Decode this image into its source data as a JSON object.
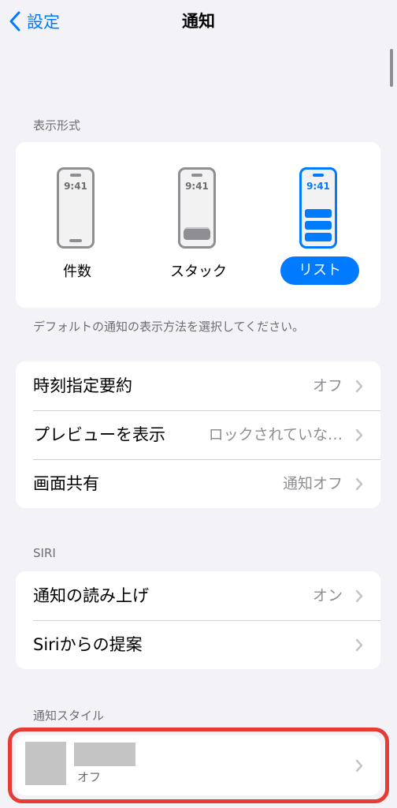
{
  "nav": {
    "back_label": "設定",
    "title": "通知"
  },
  "display_style": {
    "header": "表示形式",
    "options": [
      {
        "label": "件数",
        "time": "9:41",
        "selected": false
      },
      {
        "label": "スタック",
        "time": "9:41",
        "selected": false
      },
      {
        "label": "リスト",
        "time": "9:41",
        "selected": true
      }
    ],
    "footer": "デフォルトの通知の表示方法を選択してください。"
  },
  "general": {
    "rows": [
      {
        "label": "時刻指定要約",
        "value": "オフ"
      },
      {
        "label": "プレビューを表示",
        "value": "ロックされていな…"
      },
      {
        "label": "画面共有",
        "value": "通知オフ"
      }
    ]
  },
  "siri": {
    "header": "SIRI",
    "rows": [
      {
        "label": "通知の読み上げ",
        "value": "オン"
      },
      {
        "label": "Siriからの提案",
        "value": ""
      }
    ]
  },
  "notification_style": {
    "header": "通知スタイル",
    "apps": [
      {
        "subtitle": "オフ"
      }
    ]
  },
  "colors": {
    "accent": "#007aff",
    "highlight": "#e53d35",
    "background": "#f2f2f7"
  }
}
